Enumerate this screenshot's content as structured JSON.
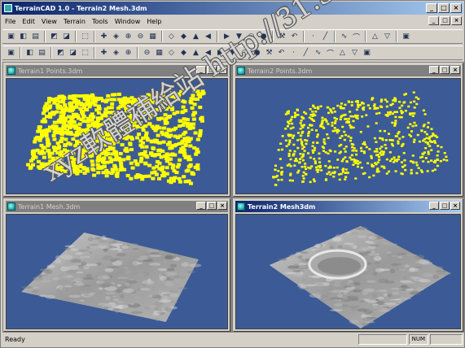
{
  "app": {
    "title": "TerrainCAD 1.0 - Terrain2 Mesh.3dm"
  },
  "window_controls": [
    "_",
    "□",
    "×"
  ],
  "menu": [
    "File",
    "Edit",
    "View",
    "Terrain",
    "Tools",
    "Window",
    "Help"
  ],
  "toolbar1_icons": [
    "new-icon",
    "open-icon",
    "save-icon",
    "sep",
    "print-icon",
    "preview-icon",
    "sep",
    "properties-icon",
    "sep",
    "select-icon",
    "pan-icon",
    "zoom-icon",
    "zoom-in-icon",
    "zoom-out-icon",
    "sep",
    "view-front-icon",
    "view-top-icon",
    "view-side-icon",
    "view-iso-icon",
    "sep",
    "rotate1-icon",
    "rotate2-icon",
    "rotate3-icon",
    "rotate4-icon",
    "sep",
    "box1-icon",
    "box2-icon",
    "sep",
    "layer1-icon",
    "layer2-icon",
    "sep",
    "circle1-icon",
    "circle2-icon",
    "sep",
    "grid-icon",
    "target-icon",
    "sep",
    "tool-icon"
  ],
  "toolbar2_icons": [
    "undo-icon",
    "sep",
    "point-icon",
    "line-icon",
    "sep",
    "pencil-icon",
    "curve-icon",
    "polyline-icon",
    "sep",
    "poly1-icon",
    "poly2-icon",
    "poly3-icon",
    "sep",
    "bar-icon",
    "mesh-icon",
    "tri1-icon",
    "tri2-icon",
    "tri3-icon",
    "tri4-icon",
    "tri5-icon",
    "tri6-icon",
    "tri7-icon",
    "tri8-icon",
    "tri9-icon",
    "tri10-icon",
    "tri11-icon",
    "tri12-icon",
    "tri13-icon",
    "tri14-icon",
    "tri15-icon",
    "tri16-icon",
    "tri17-icon"
  ],
  "windows": [
    {
      "title": "Terrain1 Points.3dm",
      "kind": "points1",
      "state": "inactive"
    },
    {
      "title": "Terrain2 Points.3dm",
      "kind": "points2",
      "state": "inactive"
    },
    {
      "title": "Terrain1 Mesh.3dm",
      "kind": "mesh1",
      "state": "inactive"
    },
    {
      "title": "Terrain2 Mesh3dm",
      "kind": "mesh2",
      "state": "active"
    }
  ],
  "status": {
    "text": "Ready",
    "num": "NUM"
  },
  "colors": {
    "viewport_bg": "#3c5a96",
    "points": "#ffff00",
    "title_active": "#0a246a"
  },
  "watermark": "xyz軟體補給站 http://31.3"
}
